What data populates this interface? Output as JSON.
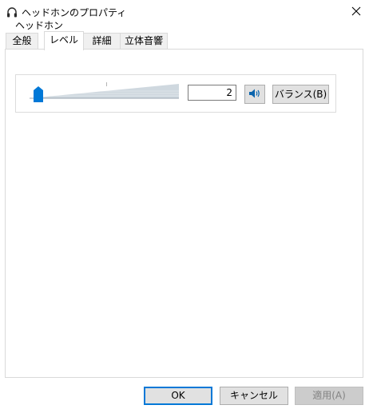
{
  "window": {
    "title": "ヘッドホンのプロパティ",
    "title_icon": "headphones-icon",
    "close_icon": "close-icon"
  },
  "tabs": [
    {
      "label": "全般",
      "active": false
    },
    {
      "label": "レベル",
      "active": true
    },
    {
      "label": "詳細",
      "active": false
    },
    {
      "label": "立体音響",
      "active": false
    }
  ],
  "level": {
    "group_label": "ヘッドホン",
    "value": "2",
    "slider_level_percent": 2,
    "mute_icon": "speaker-icon",
    "balance_label": "バランス(B)"
  },
  "footer": {
    "ok_label": "OK",
    "cancel_label": "キャンセル",
    "apply_label": "適用(A)"
  },
  "colors": {
    "accent": "#0078d7",
    "button_face": "#e1e1e1",
    "disabled_text": "#838383"
  }
}
